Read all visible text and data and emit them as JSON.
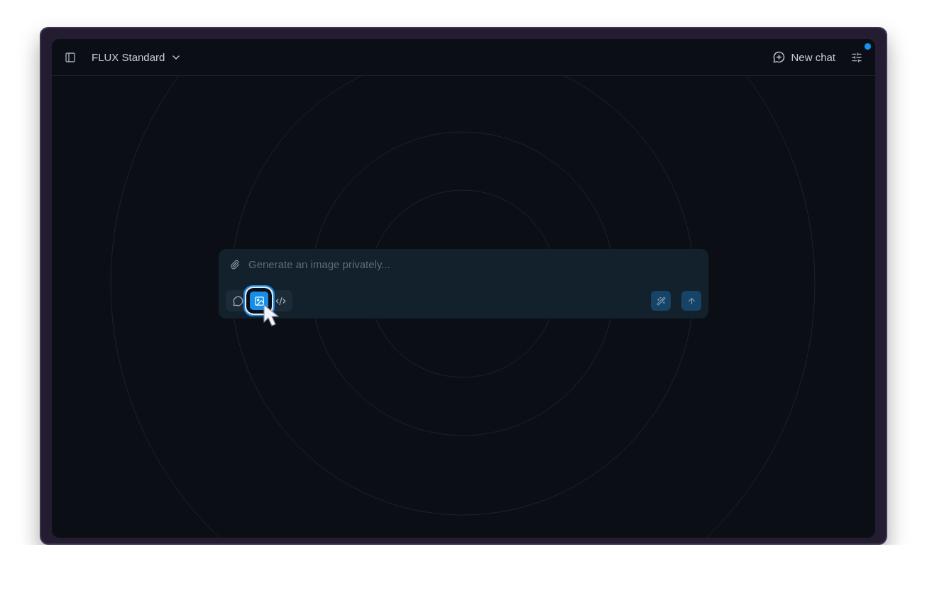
{
  "header": {
    "model": "FLUX Standard",
    "new_chat": "New chat",
    "settings_notification": true
  },
  "composer": {
    "placeholder": "Generate an image privately...",
    "modes": [
      {
        "kind": "chat",
        "selected": false
      },
      {
        "kind": "image",
        "selected": true
      },
      {
        "kind": "code",
        "selected": false
      }
    ]
  }
}
